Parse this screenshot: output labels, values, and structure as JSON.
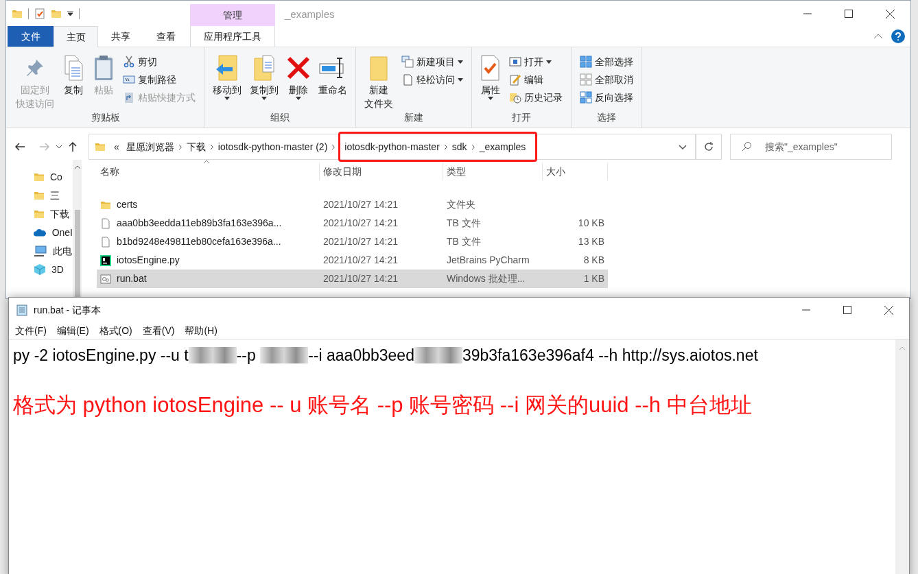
{
  "explorer": {
    "title": "_examples",
    "context_tab": {
      "group": "管理",
      "label": "应用程序工具"
    },
    "tabs": [
      {
        "label": "文件",
        "kind": "file",
        "selected": false
      },
      {
        "label": "主页",
        "kind": "tab",
        "selected": true
      },
      {
        "label": "共享",
        "kind": "tab",
        "selected": false
      },
      {
        "label": "查看",
        "kind": "tab",
        "selected": false
      }
    ],
    "ribbon": [
      {
        "label": "剪贴板",
        "items": [
          {
            "lines": [
              "固定到",
              "快速访问"
            ],
            "kind": "large",
            "disabled": true,
            "dropdown": false
          },
          {
            "lines": [
              "复制"
            ],
            "kind": "large",
            "disabled": false,
            "dropdown": false
          },
          {
            "lines": [
              "粘贴"
            ],
            "kind": "large",
            "disabled": true,
            "dropdown": false
          },
          {
            "label": "剪切",
            "kind": "small",
            "disabled": false,
            "dropdown": false
          },
          {
            "label": "复制路径",
            "kind": "small",
            "disabled": false,
            "dropdown": false
          },
          {
            "label": "粘贴快捷方式",
            "kind": "small",
            "disabled": true,
            "dropdown": false
          }
        ]
      },
      {
        "label": "组织",
        "items": [
          {
            "lines": [
              "移动到"
            ],
            "kind": "large",
            "disabled": false,
            "dropdown": true
          },
          {
            "lines": [
              "复制到"
            ],
            "kind": "large",
            "disabled": false,
            "dropdown": true
          },
          {
            "lines": [
              "删除"
            ],
            "kind": "large",
            "disabled": false,
            "dropdown": true
          },
          {
            "lines": [
              "重命名"
            ],
            "kind": "large",
            "disabled": false,
            "dropdown": false
          }
        ]
      },
      {
        "label": "新建",
        "items": [
          {
            "lines": [
              "新建",
              "文件夹"
            ],
            "kind": "large",
            "disabled": false,
            "dropdown": false
          },
          {
            "label": "新建项目",
            "kind": "small",
            "disabled": false,
            "dropdown": true
          },
          {
            "label": "轻松访问",
            "kind": "small",
            "disabled": false,
            "dropdown": true
          }
        ]
      },
      {
        "label": "打开",
        "items": [
          {
            "lines": [
              "属性"
            ],
            "kind": "large",
            "disabled": false,
            "dropdown": true
          },
          {
            "label": "打开",
            "kind": "small",
            "disabled": false,
            "dropdown": true
          },
          {
            "label": "编辑",
            "kind": "small",
            "disabled": false,
            "dropdown": false
          },
          {
            "label": "历史记录",
            "kind": "small",
            "disabled": false,
            "dropdown": false
          }
        ]
      },
      {
        "label": "选择",
        "items": [
          {
            "label": "全部选择",
            "kind": "small",
            "disabled": false,
            "dropdown": false
          },
          {
            "label": "全部取消",
            "kind": "small",
            "disabled": false,
            "dropdown": false
          },
          {
            "label": "反向选择",
            "kind": "small",
            "disabled": false,
            "dropdown": false
          }
        ]
      }
    ],
    "address": {
      "overflow": "«",
      "crumbs": [
        {
          "label": "星愿浏览器",
          "highlighted": false
        },
        {
          "label": "下载",
          "highlighted": false
        },
        {
          "label": "iotosdk-python-master (2)",
          "highlighted": false
        },
        {
          "label": "iotosdk-python-master",
          "highlighted": true
        },
        {
          "label": "sdk",
          "highlighted": true
        },
        {
          "label": "_examples",
          "highlighted": true
        }
      ]
    },
    "search": {
      "placeholder": "搜索\"_examples\""
    },
    "nav": [
      {
        "label": "Co",
        "kind": "folder"
      },
      {
        "label": "三",
        "kind": "folder"
      },
      {
        "label": "下载",
        "kind": "folder"
      },
      {
        "label": "OneI",
        "kind": "cloud"
      },
      {
        "label": "此电",
        "kind": "pc"
      },
      {
        "label": "3D",
        "kind": "cube"
      }
    ],
    "columns": [
      "名称",
      "修改日期",
      "类型",
      "大小"
    ],
    "rows": [
      {
        "kind": "folder",
        "name": "certs",
        "date": "2021/10/27 14:21",
        "type": "文件夹",
        "size": "",
        "selected": false
      },
      {
        "kind": "file",
        "name": "aaa0bb3eedda11eb89b3fa163e396a...",
        "date": "2021/10/27 14:21",
        "type": "TB 文件",
        "size": "10 KB",
        "selected": false
      },
      {
        "kind": "file",
        "name": "b1bd9248e49811eb80cefa163e396a...",
        "date": "2021/10/27 14:21",
        "type": "TB 文件",
        "size": "13 KB",
        "selected": false
      },
      {
        "kind": "pycharm",
        "name": "iotosEngine.py",
        "date": "2021/10/27 14:21",
        "type": "JetBrains PyCharm",
        "size": "8 KB",
        "selected": false
      },
      {
        "kind": "bat",
        "name": "run.bat",
        "date": "2021/10/27 14:21",
        "type": "Windows 批处理...",
        "size": "1 KB",
        "selected": true
      }
    ]
  },
  "notepad": {
    "title": "run.bat - 记事本",
    "menu": [
      "文件(F)",
      "编辑(E)",
      "格式(O)",
      "查看(V)",
      "帮助(H)"
    ],
    "lines": [
      {
        "kind": "command",
        "segments": [
          {
            "kind": "text",
            "text": "py -2 iotosEngine.py --u t"
          },
          {
            "kind": "redacted"
          },
          {
            "kind": "text",
            "text": "--p "
          },
          {
            "kind": "redacted"
          },
          {
            "kind": "text",
            "text": "--i aaa0bb3eed"
          },
          {
            "kind": "redacted"
          },
          {
            "kind": "text",
            "text": "39b3fa163e396af4 --h http://sys.aiotos.net"
          }
        ]
      },
      {
        "kind": "blank"
      },
      {
        "kind": "note",
        "text": "格式为 python iotosEngine -- u 账号名 --p 账号密码 --i 网关的uuid --h 中台地址"
      }
    ]
  }
}
